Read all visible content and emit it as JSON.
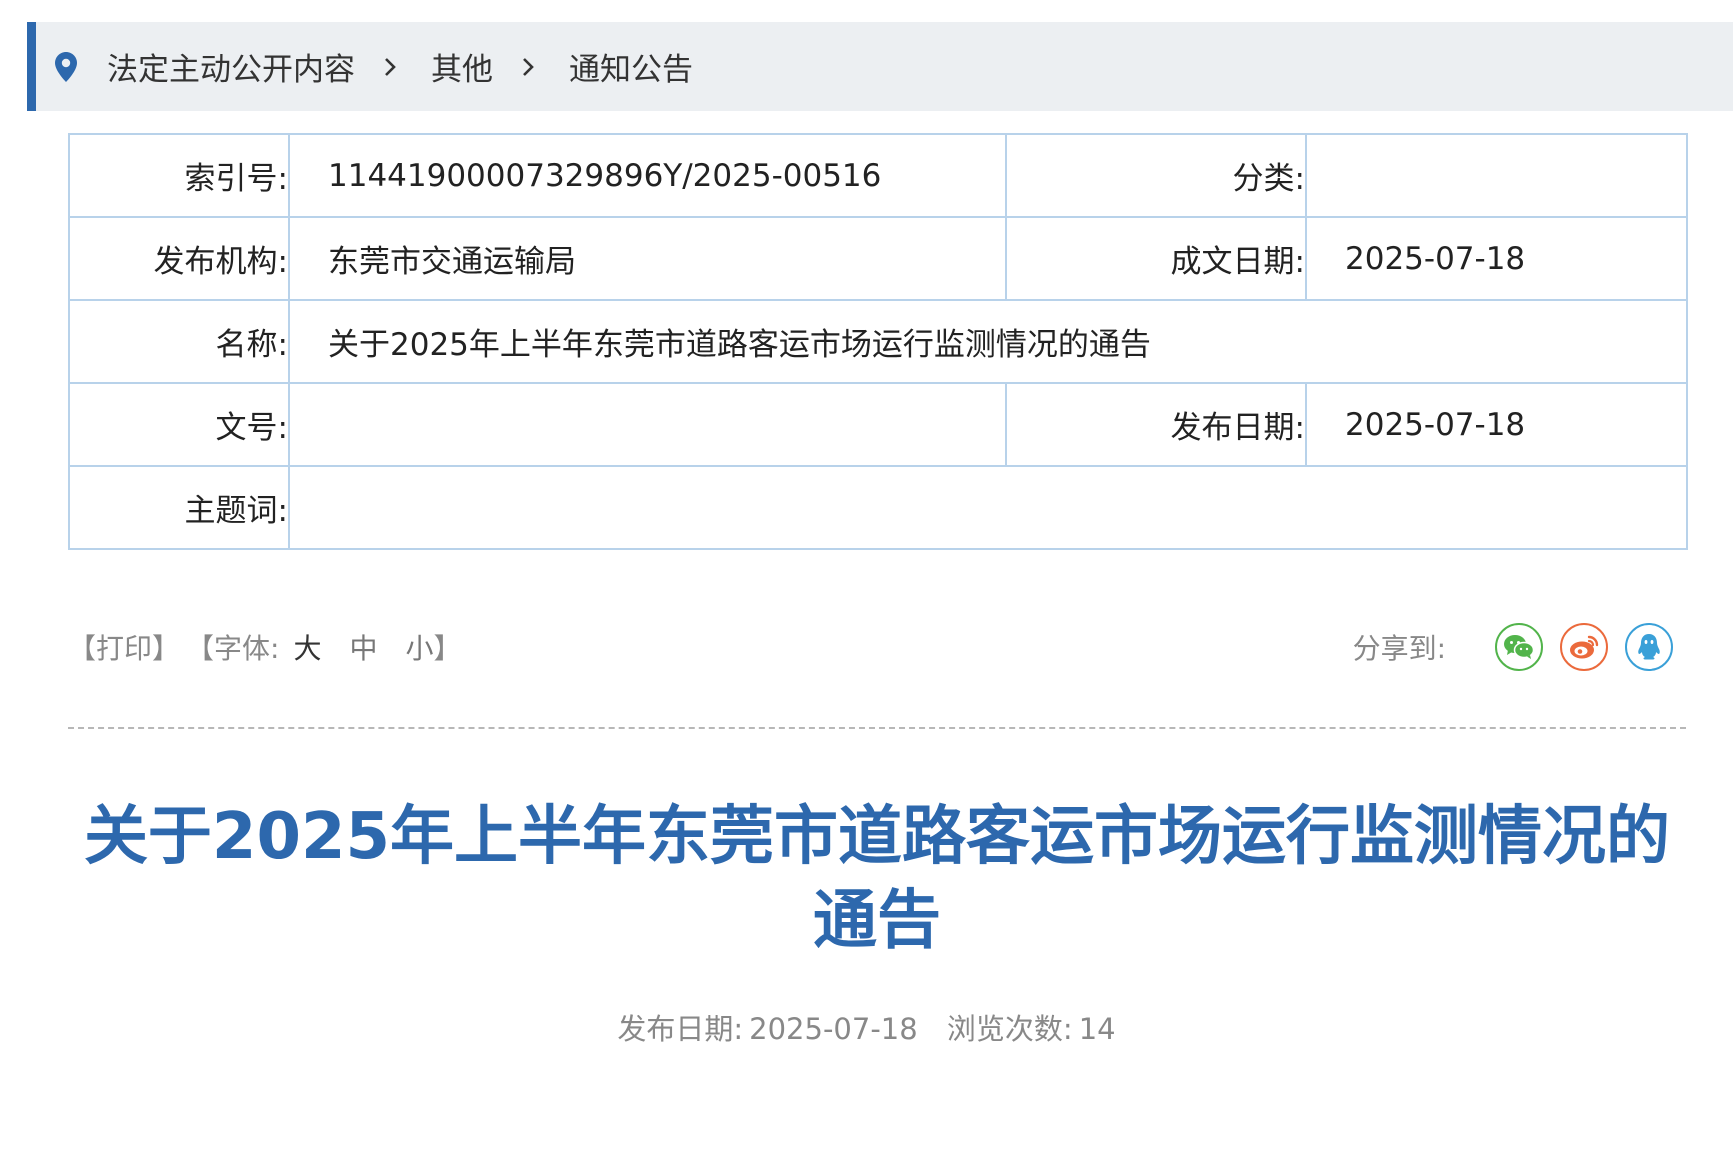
{
  "breadcrumb": {
    "items": [
      "法定主动公开内容",
      "其他",
      "通知公告"
    ]
  },
  "meta": {
    "index_label": "索引号:",
    "index_value": "11441900007329896Y/2025-00516",
    "category_label": "分类:",
    "category_value": "",
    "publisher_label": "发布机构:",
    "publisher_value": "东莞市交通运输局",
    "written_date_label": "成文日期:",
    "written_date_value": "2025-07-18",
    "name_label": "名称:",
    "name_value": "关于2025年上半年东莞市道路客运市场运行监测情况的通告",
    "doc_no_label": "文号:",
    "doc_no_value": "",
    "publish_date_label": "发布日期:",
    "publish_date_value": "2025-07-18",
    "keywords_label": "主题词:",
    "keywords_value": ""
  },
  "toolbar": {
    "print_label": "【打印】",
    "font_prefix": "【字体:",
    "font_large": "大",
    "font_medium": "中",
    "font_small": "小",
    "font_suffix": "】",
    "share_label": "分享到:"
  },
  "share_icons": [
    "wechat-icon",
    "weibo-icon",
    "qq-icon"
  ],
  "colors": {
    "accent": "#2d68ad",
    "breadcrumb_bg": "#eceff2",
    "table_border": "#b8d2ea",
    "wechat": "#52b44b",
    "weibo": "#eb6a3c",
    "qq": "#3aa0d8"
  },
  "article": {
    "title": "关于2025年上半年东莞市道路客运市场运行监测情况的通告",
    "publish_date_label": "发布日期:",
    "publish_date": "2025-07-18",
    "views_label": "浏览次数:",
    "views": "14"
  }
}
